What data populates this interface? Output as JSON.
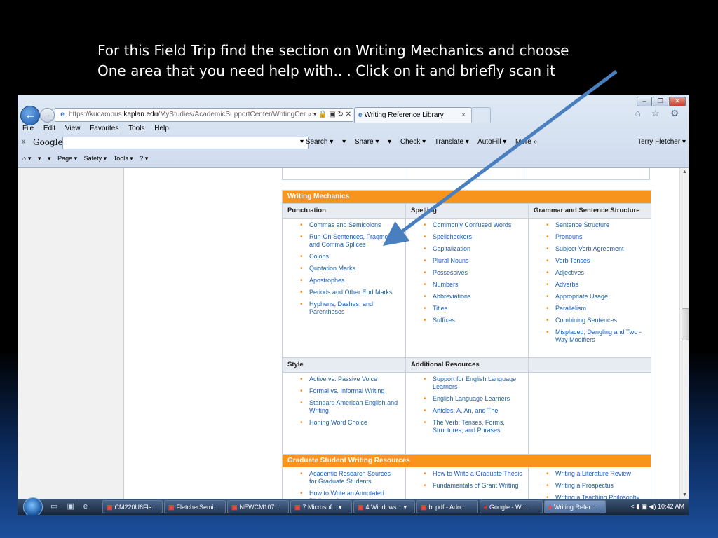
{
  "slide": {
    "title_line1": "For this Field Trip find the section on Writing Mechanics and choose",
    "title_line2": "One area that you need help with.. . Click on it and briefly scan it"
  },
  "browser": {
    "window_buttons": [
      "–",
      "❐",
      "✕"
    ],
    "back_icon": "back-arrow-icon",
    "forward_icon": "forward-arrow-icon",
    "address": {
      "prefix": "https://kucampus.",
      "host": "kaplan.edu",
      "path": "/MyStudies/AcademicSupportCenter/WritingCenter/",
      "tools": "⌕ ▾ 🔒 ▣ ↻ ✕"
    },
    "tab": {
      "label": "Writing Reference Library",
      "close": "×"
    },
    "right_icons": "⌂ ☆ ⚙",
    "menu": [
      "File",
      "Edit",
      "View",
      "Favorites",
      "Tools",
      "Help"
    ],
    "google_bar": {
      "close": "x",
      "logo": "Google",
      "items": [
        "▾ Search ▾",
        "▾",
        "Share ▾",
        "▾",
        "Check ▾",
        "Translate ▾",
        "AutoFill ▾",
        "More »"
      ],
      "user": "Terry Fletcher ▾"
    },
    "command_bar": [
      "⌂ ▾",
      "▾",
      "▾",
      "Page ▾",
      "Safety ▾",
      "Tools ▾",
      "? ▾"
    ]
  },
  "content": {
    "writing_mechanics": {
      "header": "Writing Mechanics",
      "columns": [
        {
          "title": "Punctuation",
          "items": [
            "Commas and Semicolons",
            "Run-On Sentences, Fragments, and Comma Splices",
            "Colons",
            "Quotation Marks",
            "Apostrophes",
            "Periods and Other End Marks",
            "Hyphens, Dashes, and Parentheses"
          ]
        },
        {
          "title": "Spelling",
          "items": [
            "Commonly Confused Words",
            "Spellcheckers",
            "Capitalization",
            "Plural Nouns",
            "Possessives",
            "Numbers",
            "Abbreviations",
            "Titles",
            "Suffixes"
          ]
        },
        {
          "title": "Grammar and Sentence Structure",
          "items": [
            "Sentence Structure",
            "Pronouns",
            "Subject-Verb Agreement",
            "Verb Tenses",
            "Adjectives",
            "Adverbs",
            "Appropriate Usage",
            "Parallelism",
            "Combining Sentences",
            "Misplaced, Dangling and Two -Way Modifiers"
          ]
        }
      ]
    },
    "style_resources": {
      "columns": [
        {
          "title": "Style",
          "items": [
            "Active vs. Passive Voice",
            "Formal vs. Informal Writing",
            "Standard American English and Writing",
            "Honing Word Choice"
          ]
        },
        {
          "title": "Additional Resources",
          "items": [
            "Support for English Language Learners",
            "English Language Learners",
            "Articles: A, An, and The",
            "The Verb: Tenses, Forms, Structures, and Phrases"
          ]
        },
        {
          "title": "",
          "items": []
        }
      ]
    },
    "graduate": {
      "header": "Graduate Student Writing Resources",
      "columns": [
        {
          "title": "",
          "items": [
            "Academic Research Sources for Graduate Students",
            "How to Write an Annotated Bibliography"
          ]
        },
        {
          "title": "",
          "items": [
            "How to Write a Graduate Thesis",
            "Fundamentals of Grant Writing"
          ]
        },
        {
          "title": "",
          "items": [
            "Writing a Literature Review",
            "Writing a Prospectus",
            "Writing a Teaching Philosophy"
          ]
        }
      ]
    }
  },
  "taskbar": {
    "items": [
      {
        "label": "CM220U6Fle...",
        "icon": "▣"
      },
      {
        "label": "FletcherSemi...",
        "icon": "▣"
      },
      {
        "label": "NEWCM107...",
        "icon": "▣"
      },
      {
        "label": "7 Microsof... ▾",
        "icon": "▣"
      },
      {
        "label": "4 Windows... ▾",
        "icon": "▣"
      },
      {
        "label": "bi.pdf - Ado...",
        "icon": "▣"
      },
      {
        "label": "Google - Wi...",
        "icon": "e"
      },
      {
        "label": "Writing Refer...",
        "icon": "e"
      }
    ],
    "time": "10:42 AM"
  },
  "colors": {
    "accent_orange": "#f7941d",
    "link_blue": "#1c5fb4",
    "arrow_blue": "#4a7fbf"
  }
}
